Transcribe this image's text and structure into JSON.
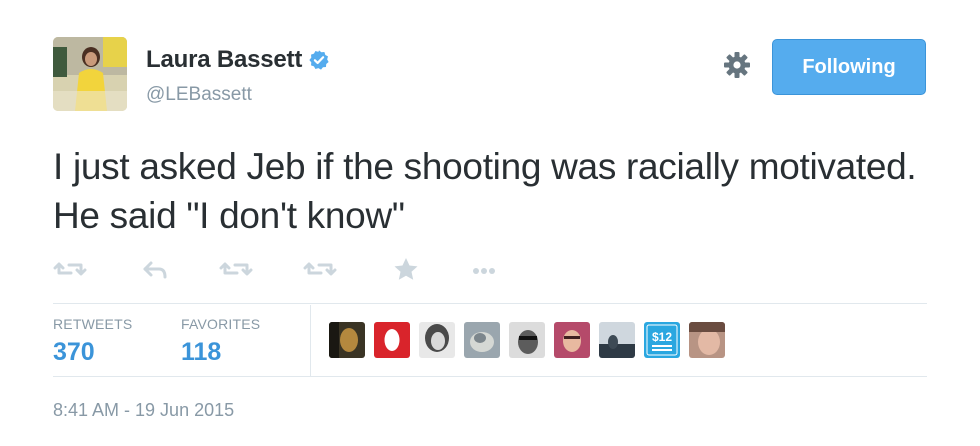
{
  "author": {
    "name": "Laura Bassett",
    "handle": "@LEBassett",
    "verified": true,
    "avatar_icon": "profile-photo"
  },
  "header": {
    "settings_icon": "gear-icon",
    "follow_label": "Following"
  },
  "tweet": {
    "text": "I just asked Jeb if the shooting was racially motivated. He said \"I don't know\""
  },
  "actions": [
    "reply-icon",
    "retweet-icon",
    "retweet-icon",
    "retweet-icon",
    "star-icon",
    "more-icon"
  ],
  "stats": {
    "retweets_label": "RETWEETS",
    "retweets_value": "370",
    "favorites_label": "FAVORITES",
    "favorites_value": "118"
  },
  "facepile": {
    "badge_amount": "$12"
  },
  "timestamp": "8:41 AM - 19 Jun 2015",
  "colors": {
    "accent": "#55acee",
    "stat_value": "#3b94d9",
    "muted": "#8899a6",
    "text": "#292f33"
  }
}
